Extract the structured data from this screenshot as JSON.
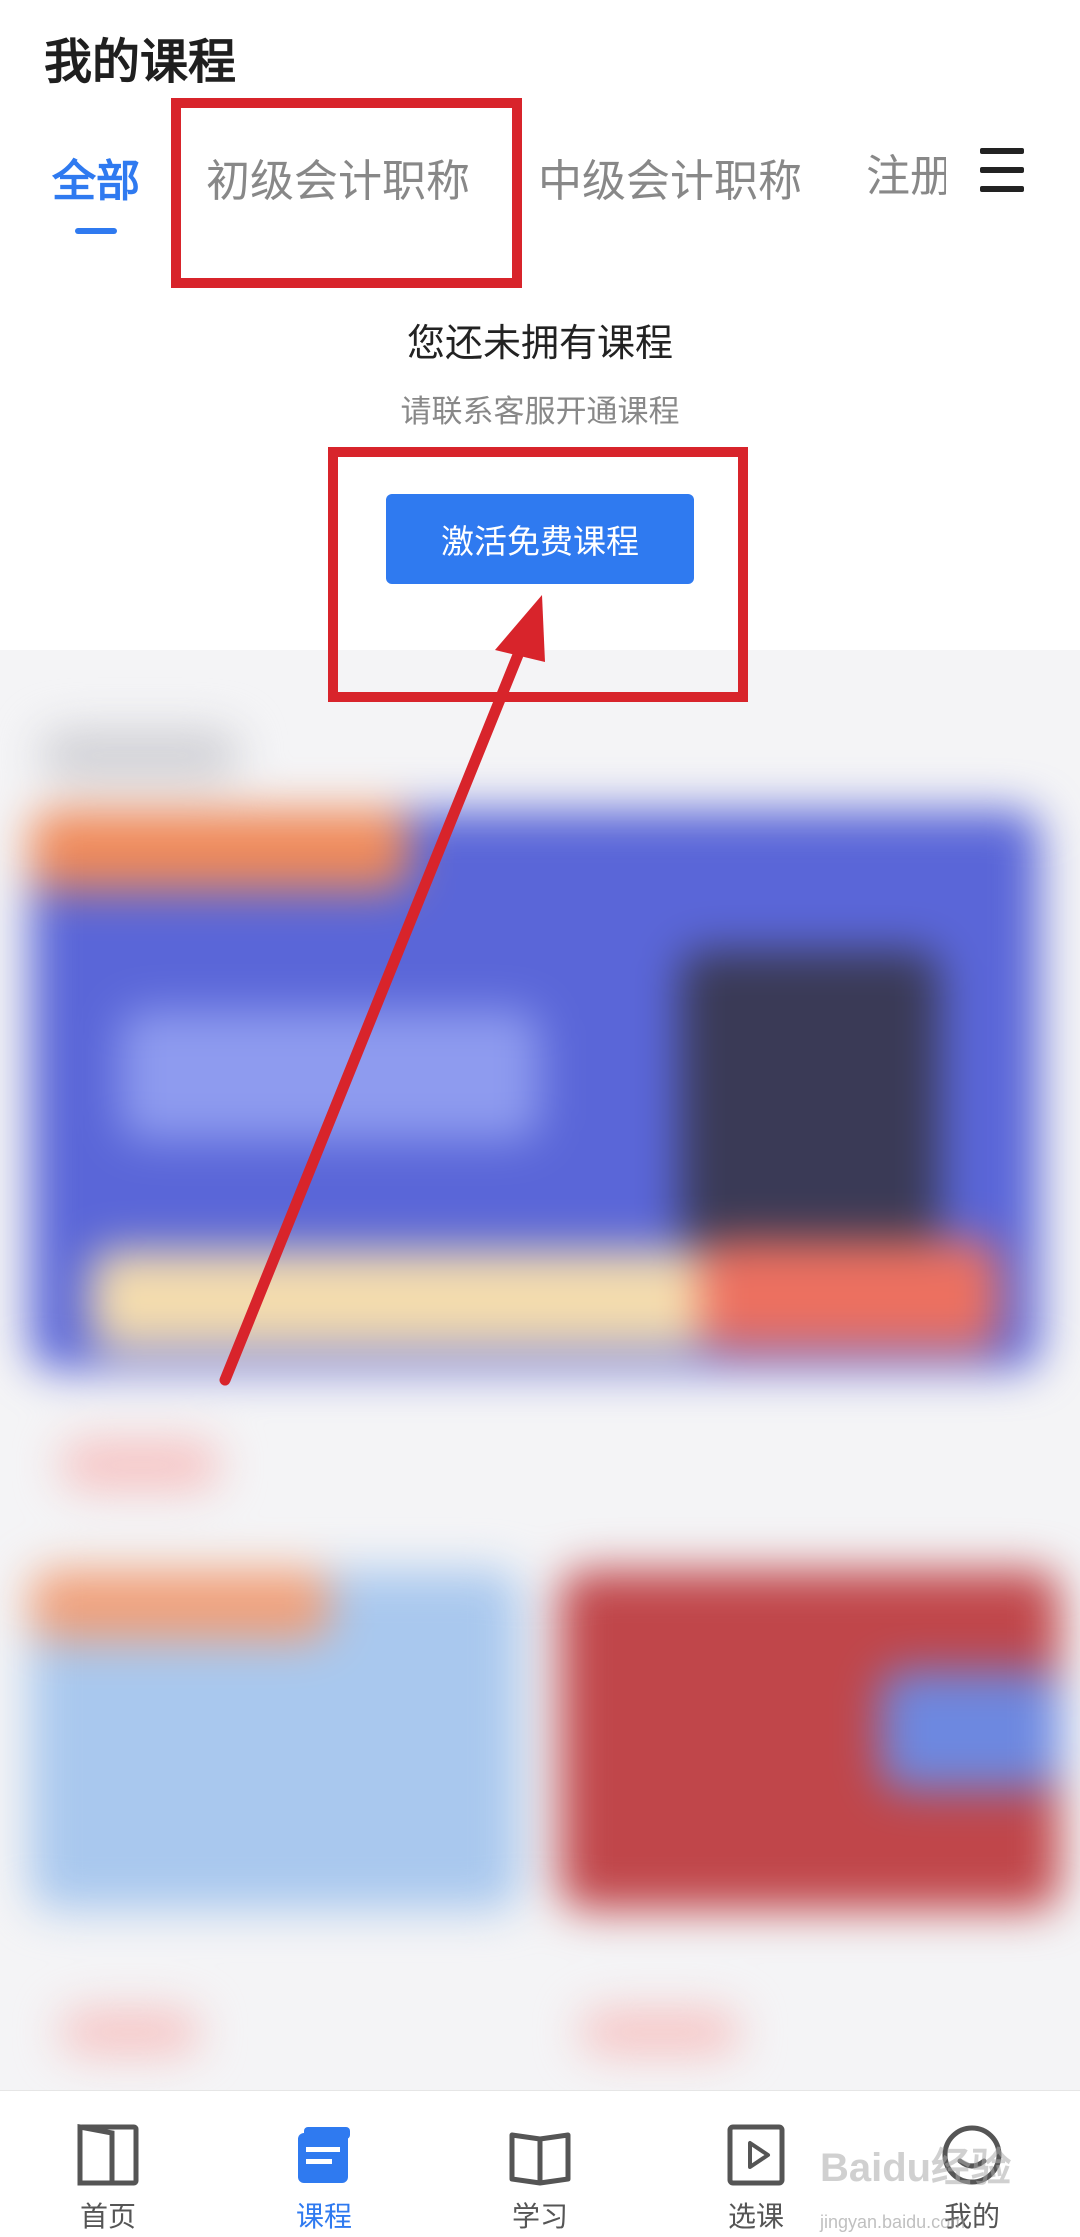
{
  "header": {
    "title": "我的课程"
  },
  "tabs": [
    {
      "label": "全部",
      "active": true
    },
    {
      "label": "初级会计职称",
      "active": false
    },
    {
      "label": "中级会计职称",
      "active": false
    },
    {
      "label": "注册",
      "active": false
    }
  ],
  "empty_state": {
    "title": "您还未拥有课程",
    "subtitle": "请联系客服开通课程",
    "button_label": "激活免费课程"
  },
  "bottom_nav": [
    {
      "label": "首页",
      "icon": "home-icon",
      "active": false
    },
    {
      "label": "课程",
      "icon": "course-icon",
      "active": true
    },
    {
      "label": "学习",
      "icon": "book-icon",
      "active": false
    },
    {
      "label": "选课",
      "icon": "play-icon",
      "active": false
    },
    {
      "label": "我的",
      "icon": "profile-icon",
      "active": false
    }
  ],
  "watermark": {
    "text": "Baidu经验",
    "sub": "jingyan.baidu.com"
  },
  "colors": {
    "accent": "#2f7af0",
    "annotation_red": "#d8242b"
  }
}
